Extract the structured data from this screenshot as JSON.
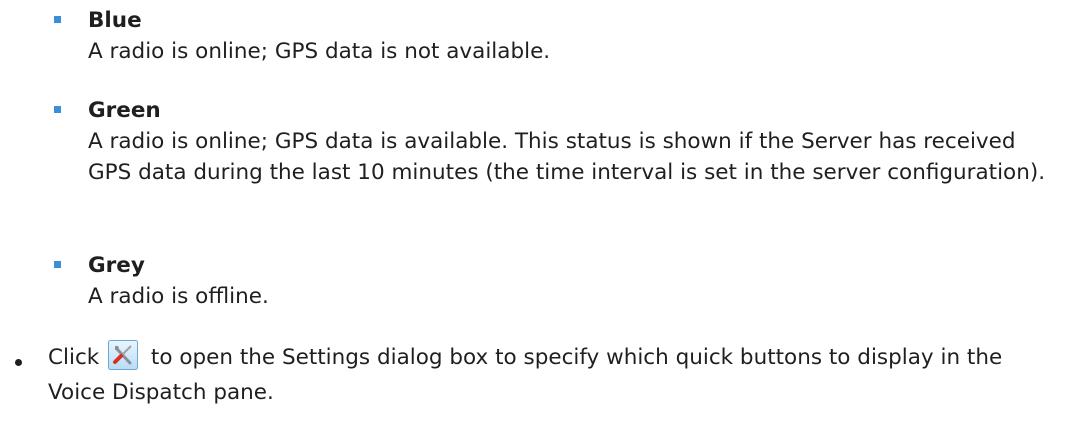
{
  "statuses": [
    {
      "title": "Blue",
      "description": "A radio is online; GPS data is not available."
    },
    {
      "title": "Green",
      "description": "A radio is online; GPS data is available. This status is shown if the Server has received GPS data during the last 10 minutes (the time interval is set in the server configuration)."
    },
    {
      "title": "Grey",
      "description": "A radio is offline."
    }
  ],
  "settings_item": {
    "prefix": "Click",
    "icon": "settings-tools-icon",
    "suffix": "to open the Settings dialog box to specify which quick buttons to display in the Voice Dispatch pane."
  },
  "colors": {
    "bullet_accent": "#3b8fd9",
    "text": "#1f1f1f"
  }
}
